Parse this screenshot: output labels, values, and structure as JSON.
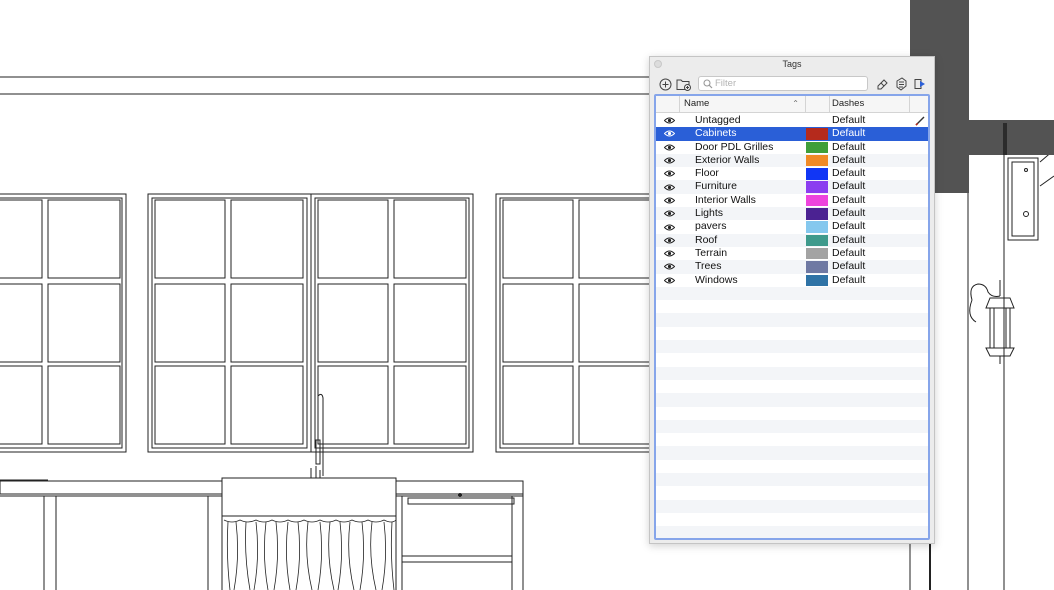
{
  "panel": {
    "title": "Tags",
    "filter_placeholder": "Filter",
    "columns": {
      "name": "Name",
      "dashes": "Dashes"
    }
  },
  "tags": [
    {
      "name": "Untagged",
      "dashes": "Default",
      "color": "",
      "selected": false,
      "active": true
    },
    {
      "name": "Cabinets",
      "dashes": "Default",
      "color": "#b52a1c",
      "selected": true,
      "active": false
    },
    {
      "name": "Door PDL Grilles",
      "dashes": "Default",
      "color": "#3f9e3a",
      "selected": false,
      "active": false
    },
    {
      "name": "Exterior Walls",
      "dashes": "Default",
      "color": "#f08a26",
      "selected": false,
      "active": false
    },
    {
      "name": "Floor",
      "dashes": "Default",
      "color": "#1136f5",
      "selected": false,
      "active": false
    },
    {
      "name": "Furniture",
      "dashes": "Default",
      "color": "#8b3df0",
      "selected": false,
      "active": false
    },
    {
      "name": "Interior Walls",
      "dashes": "Default",
      "color": "#ee44dd",
      "selected": false,
      "active": false
    },
    {
      "name": "Lights",
      "dashes": "Default",
      "color": "#4b2292",
      "selected": false,
      "active": false
    },
    {
      "name": "pavers",
      "dashes": "Default",
      "color": "#85c8ee",
      "selected": false,
      "active": false
    },
    {
      "name": "Roof",
      "dashes": "Default",
      "color": "#3f9a8c",
      "selected": false,
      "active": false
    },
    {
      "name": "Terrain",
      "dashes": "Default",
      "color": "#a3a3a3",
      "selected": false,
      "active": false
    },
    {
      "name": "Trees",
      "dashes": "Default",
      "color": "#6f79a3",
      "selected": false,
      "active": false
    },
    {
      "name": "Windows",
      "dashes": "Default",
      "color": "#2f73a6",
      "selected": false,
      "active": false
    }
  ],
  "toolbar_icons": [
    "add-tag-icon",
    "add-folder-icon",
    "search-icon",
    "eraser-icon",
    "color-by-tag-icon",
    "export-icon"
  ],
  "colors": {
    "accent": "#2a5fd7",
    "focus": "#86a5ea"
  }
}
